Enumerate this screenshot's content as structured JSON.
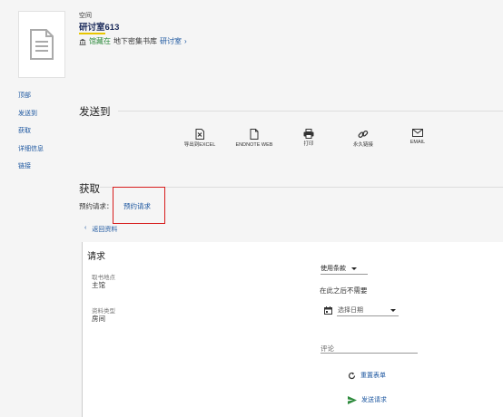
{
  "record": {
    "type": "空间",
    "title_highlight": "研讨室",
    "title_rest": "613",
    "location_status": "馆藏在",
    "location_place": "地下密集书库",
    "location_link": "研讨室",
    "location_chevron": "›"
  },
  "sidebar": {
    "items": [
      {
        "label": "顶部"
      },
      {
        "label": "发送到"
      },
      {
        "label": "获取"
      },
      {
        "label": "详细信息"
      },
      {
        "label": "链接"
      }
    ]
  },
  "send_to": {
    "heading": "发送到",
    "actions": [
      {
        "label": "导出到EXCEL",
        "icon": "excel-icon"
      },
      {
        "label": "ENDNOTE WEB",
        "icon": "document-icon"
      },
      {
        "label": "打印",
        "icon": "print-icon"
      },
      {
        "label": "永久链接",
        "icon": "link-icon"
      },
      {
        "label": "EMAIL",
        "icon": "email-icon"
      }
    ]
  },
  "get_it": {
    "heading": "获取",
    "booking_label": "预约请求：",
    "booking_link": "预约请求",
    "back_label": "返回资料",
    "back_chevron": "‹"
  },
  "request_form": {
    "title": "请求",
    "pickup_label": "取书地点",
    "pickup_value": "主馆",
    "material_label": "资料类型",
    "material_value": "房间",
    "terms_select": "使用条款",
    "not_needed_label": "在此之后不需要",
    "date_select": "选择日期",
    "comment_placeholder": "评论",
    "reset_label": "重置表单",
    "send_label": "发送请求"
  },
  "colors": {
    "link": "#1d57a0",
    "highlight_red": "#d71c1c",
    "status_green": "#2e8b3d",
    "title_underline": "#e8c600"
  }
}
